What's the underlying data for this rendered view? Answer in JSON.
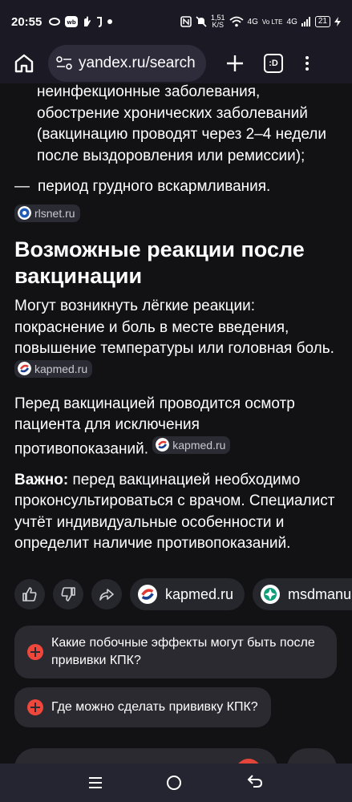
{
  "status_bar": {
    "time": "20:55",
    "network_speed_value": "1,51",
    "network_speed_unit": "K/S",
    "network_1": "4G",
    "network_2": "Vo LTE",
    "network_3": "4G",
    "battery_level": "21"
  },
  "browser": {
    "url": "yandex.ru/search",
    "tabs_label": ":D"
  },
  "article": {
    "contra_item_text": "неинфекционные заболевания, обострение хронических заболеваний (вакцинацию проводят через 2–4 недели после выздоровления или ремиссии);",
    "dash": "—",
    "list_item_text": "период грудного вскармливания.",
    "source_1": "rlsnet.ru",
    "heading": "Возможные реакции после вакцинации",
    "para1": "Могут возникнуть лёгкие реакции: покраснение и боль в месте введения, повышение температуры или головная боль.",
    "source_2": "kapmed.ru",
    "para2": "Перед вакцинацией проводится осмотр пациента для исключения противопоказаний.",
    "source_3": "kapmed.ru",
    "para3_bold": "Важно:",
    "para3": " перед вакцинацией необходимо проконсультироваться с врачом. Специалист учтёт индивидуальные особенности и определит наличие противопоказаний."
  },
  "actions": {
    "pill_1": "kapmed.ru",
    "pill_2": "msdmanuals"
  },
  "suggestions": [
    {
      "text": "Какие побочные эффекты могут быть после прививки КПК?"
    },
    {
      "text": "Где можно сделать прививку КПК?"
    }
  ],
  "colors": {
    "background": "#121214",
    "accent_red": "#f0473c"
  }
}
